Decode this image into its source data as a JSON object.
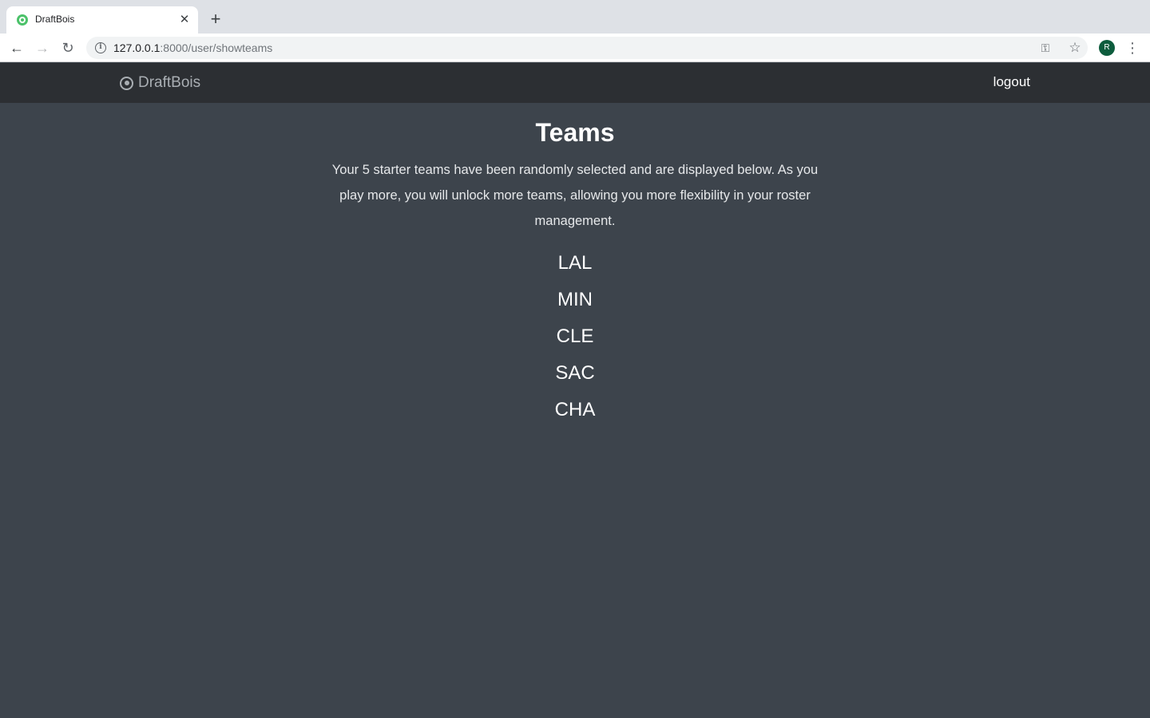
{
  "browser": {
    "tab_title": "DraftBois",
    "url_host": "127.0.0.1",
    "url_path": ":8000/user/showteams",
    "profile_initial": "R",
    "icons": {
      "favicon": "target-icon",
      "close": "close-icon",
      "new_tab": "plus-icon",
      "back": "arrow-left-icon",
      "forward": "arrow-right-icon",
      "reload": "reload-icon",
      "info": "info-icon",
      "key": "key-icon",
      "star": "star-icon",
      "menu": "kebab-menu-icon"
    }
  },
  "header": {
    "brand": "DraftBois",
    "brand_icon": "target-icon",
    "logout_label": "logout"
  },
  "main": {
    "title": "Teams",
    "intro": "Your 5 starter teams have been randomly selected and are displayed below. As you play more, you will unlock more teams, allowing you more flexibility in your roster management.",
    "teams": [
      "LAL",
      "MIN",
      "CLE",
      "SAC",
      "CHA"
    ]
  },
  "colors": {
    "header_bg": "#2c2f33",
    "page_bg": "#3d444c",
    "brand_text": "#a9aeb3",
    "text": "#ffffff"
  }
}
